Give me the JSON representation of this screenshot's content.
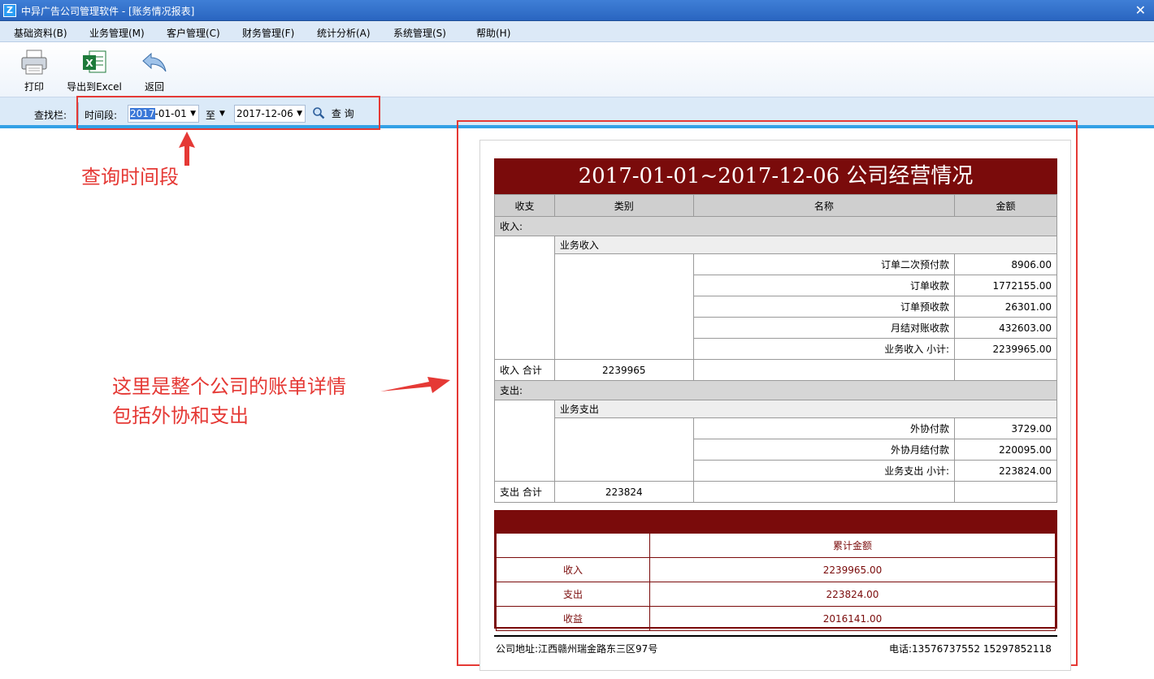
{
  "window": {
    "title": "中异广告公司管理软件 - [账务情况报表]",
    "app_icon": "Z"
  },
  "menu": [
    "基础资料(B)",
    "业务管理(M)",
    "客户管理(C)",
    "财务管理(F)",
    "统计分析(A)",
    "系统管理(S)",
    "帮助(H)"
  ],
  "toolbar": {
    "print": "打印",
    "export": "导出到Excel",
    "back": "返回"
  },
  "query": {
    "bar_label": "查找栏:",
    "period_label": "时间段:",
    "start_sel": "2017",
    "start_rest": "-01-01",
    "to": "至",
    "end_date": "2017-12-06",
    "button": "查 询"
  },
  "annotations": {
    "period": "查询时间段",
    "detail_line1": "这里是整个公司的账单详情",
    "detail_line2": "包括外协和支出"
  },
  "report": {
    "title": "2017-01-01~2017-12-06 公司经营情况",
    "headers": [
      "收支",
      "类别",
      "名称",
      "金额"
    ],
    "income": {
      "section": "收入:",
      "category": "业务收入",
      "rows": [
        {
          "name": "订单二次预付款",
          "amount": "8906.00"
        },
        {
          "name": "订单收款",
          "amount": "1772155.00"
        },
        {
          "name": "订单预收款",
          "amount": "26301.00"
        },
        {
          "name": "月结对账收款",
          "amount": "432603.00"
        }
      ],
      "subtotal_label": "业务收入 小计:",
      "subtotal": "2239965.00",
      "total_label": "收入 合计",
      "total": "2239965"
    },
    "expense": {
      "section": "支出:",
      "category": "业务支出",
      "rows": [
        {
          "name": "外协付款",
          "amount": "3729.00"
        },
        {
          "name": "外协月结付款",
          "amount": "220095.00"
        }
      ],
      "subtotal_label": "业务支出 小计:",
      "subtotal": "223824.00",
      "total_label": "支出 合计",
      "total": "223824"
    },
    "summary": {
      "header": "累计金额",
      "rows": [
        {
          "label": "收入",
          "value": "2239965.00"
        },
        {
          "label": "支出",
          "value": "223824.00"
        },
        {
          "label": "收益",
          "value": "2016141.00"
        }
      ]
    },
    "footer": {
      "address": "公司地址:江西赣州瑞金路东三区97号",
      "phone": "电话:13576737552 15297852118"
    }
  },
  "colors": {
    "report_header": "#7a0b0b",
    "annotation": "#e53935",
    "query_bar": "#dbeaf8",
    "accent_line": "#33a1e6"
  }
}
